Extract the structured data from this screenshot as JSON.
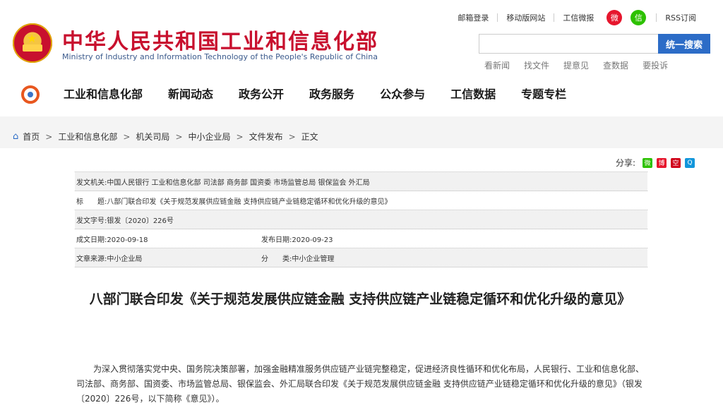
{
  "header": {
    "site_name_cn": "中华人民共和国工业和信息化部",
    "site_name_en": "Ministry of Industry and Information Technology of the People's Republic of China",
    "top_links": [
      "邮箱登录",
      "移动版网站",
      "工信微报"
    ],
    "rss_label": "RSS订阅",
    "search": {
      "placeholder": "",
      "button_label": "统一搜索"
    },
    "quick_links": [
      "看新闻",
      "找文件",
      "提意见",
      "查数据",
      "要投诉"
    ]
  },
  "nav": {
    "items": [
      "工业和信息化部",
      "新闻动态",
      "政务公开",
      "政务服务",
      "公众参与",
      "工信数据",
      "专题专栏"
    ]
  },
  "breadcrumb": [
    "首页",
    "工业和信息化部",
    "机关司局",
    "中小企业局",
    "文件发布",
    "正文"
  ],
  "share": {
    "label": "分享:"
  },
  "meta": {
    "issuer_label": "发文机关:",
    "issuer": "中国人民银行 工业和信息化部 司法部 商务部 国资委 市场监管总局 银保监会 外汇局",
    "title_label": "标　　题:",
    "title": "八部门联合印发《关于规范发展供应链金融 支持供应链产业链稳定循环和优化升级的意见》",
    "doc_no_label": "发文字号:",
    "doc_no": "银发〔2020〕226号",
    "created_label": "成文日期:",
    "created": "2020-09-18",
    "published_label": "发布日期:",
    "published": "2020-09-23",
    "source_label": "文章来源:",
    "source": "中小企业局",
    "category_label": "分　　类:",
    "category": "中小企业管理"
  },
  "article": {
    "title": "八部门联合印发《关于规范发展供应链金融 支持供应链产业链稳定循环和优化升级的意见》",
    "paragraph1": "为深入贯彻落实党中央、国务院决策部署，加强金融精准服务供应链产业链完整稳定，促进经济良性循环和优化布局，人民银行、工业和信息化部、司法部、商务部、国资委、市场监管总局、银保监会、外汇局联合印发《关于规范发展供应链金融 支持供应链产业链稳定循环和优化升级的意见》（银发〔2020〕226号，以下简称《意见》）。"
  },
  "colors": {
    "brand_red": "#c8102e",
    "accent_blue": "#2c6cc7"
  }
}
